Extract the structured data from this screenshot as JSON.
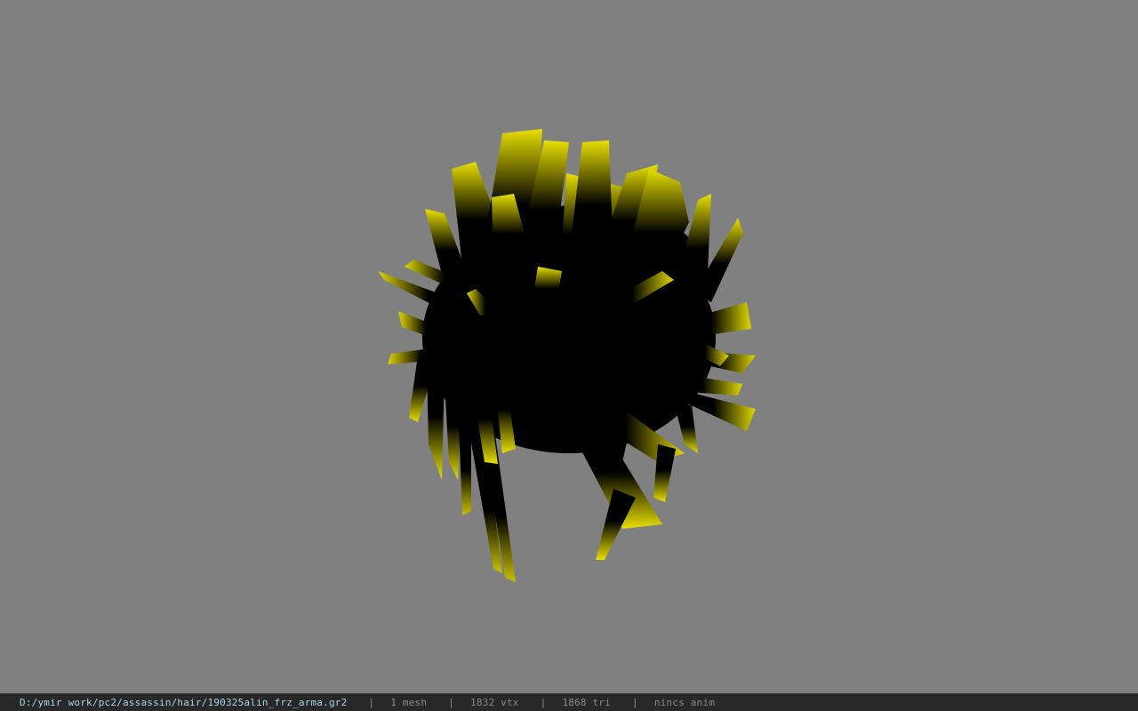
{
  "viewport": {
    "background_color": "#808080",
    "model_description": "3D hair mesh rendered with black-to-yellow gradient strands",
    "strand_color": "#ffff00",
    "shadow_color": "#000000"
  },
  "status_bar": {
    "file_path": "D:/ymir work/pc2/assassin/hair/190325alin_frz_arma.gr2",
    "separator": "|",
    "mesh_count": "1 mesh",
    "vertex_count": "1832 vtx",
    "triangle_count": "1868 tri",
    "animation": "nincs anim",
    "colors": {
      "background": "#282828",
      "path": "#a9d4e8",
      "stats": "#8a8a8a"
    }
  }
}
